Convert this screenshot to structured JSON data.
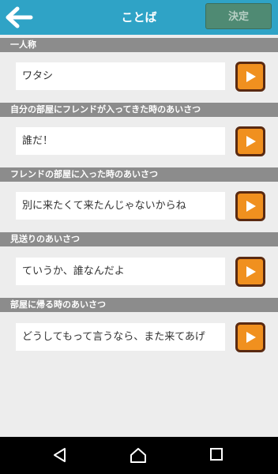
{
  "header": {
    "title": "ことば",
    "decide_label": "決定",
    "back_icon": "arrow-left-icon",
    "background_color": "#2fa3c6"
  },
  "sections": [
    {
      "label": "一人称",
      "value": "ワタシ"
    },
    {
      "label": "自分の部屋にフレンドが入ってきた時のあいさつ",
      "value": "誰だ！"
    },
    {
      "label": "フレンドの部屋に入った時のあいさつ",
      "value": "別に来たくて来たんじゃないからね"
    },
    {
      "label": "見送りのあいさつ",
      "value": "ていうか、誰なんだよ"
    },
    {
      "label": "部屋に帰る時のあいさつ",
      "value": "どうしてもって言うなら、また来てあげ"
    }
  ],
  "play_button": {
    "icon": "play-icon",
    "color": "#f0901f"
  },
  "navbar": {
    "icons": [
      "back-triangle-icon",
      "home-icon",
      "recents-icon"
    ]
  }
}
